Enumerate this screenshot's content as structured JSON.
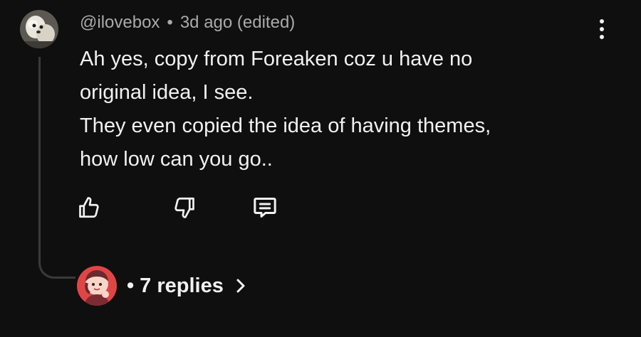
{
  "comment": {
    "author": "@ilovebox",
    "separator": "•",
    "time": "3d ago",
    "edited": "(edited)",
    "lines": [
      "Ah yes, copy from Foreaken coz u have no",
      "original idea, I see.",
      "They even copied the idea of having themes,",
      "how low can you go.."
    ]
  },
  "actions": {
    "like_icon": "thumbs-up-icon",
    "dislike_icon": "thumbs-down-icon",
    "reply_icon": "reply-message-icon",
    "menu_icon": "more-vertical-icon"
  },
  "replies": {
    "bullet": "•",
    "label": "7 replies",
    "chevron_icon": "chevron-right-icon"
  },
  "colors": {
    "background": "#0f0f0f",
    "text_primary": "#f1f1f1",
    "text_secondary": "#aaaaaa",
    "thread_line": "#3a3a3a"
  }
}
